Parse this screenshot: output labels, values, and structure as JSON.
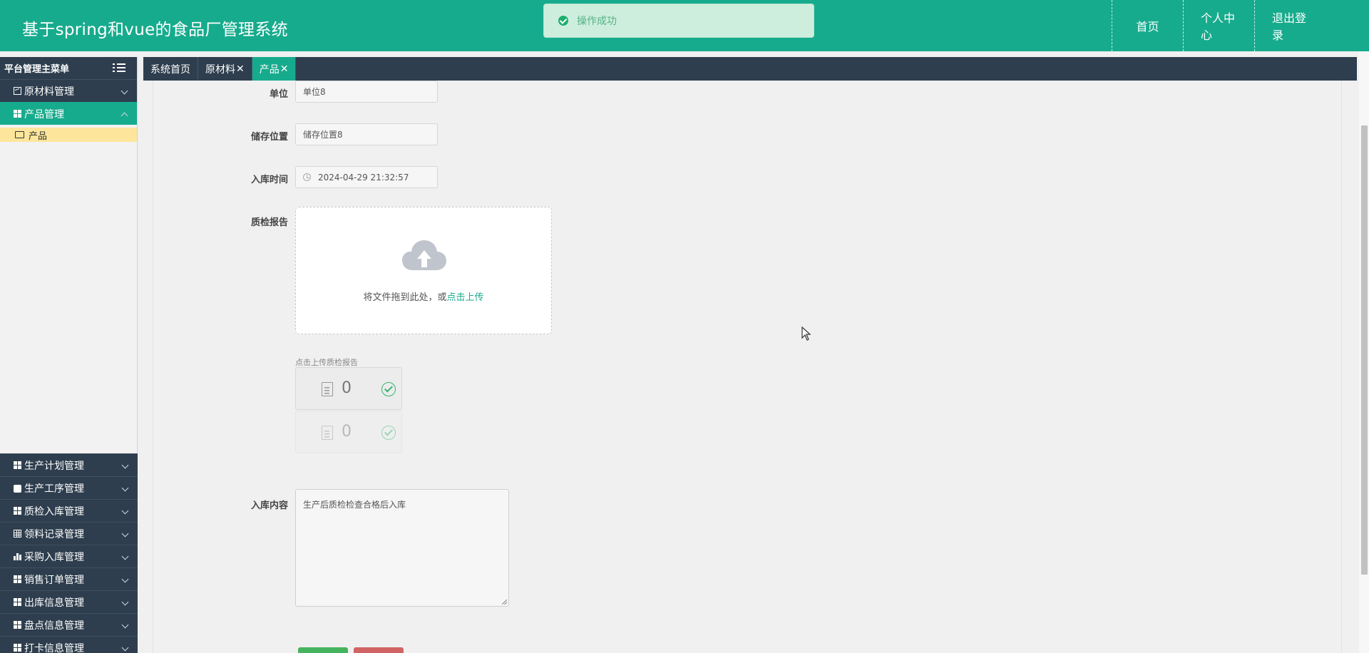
{
  "header": {
    "title": "基于spring和vue的食品厂管理系统",
    "nav": [
      "首页",
      "个人中心",
      "退出登录"
    ]
  },
  "toast": {
    "text": "操作成功",
    "icon": "success-check-icon"
  },
  "sidebar": {
    "title": "平台管理主菜单",
    "top_items": [
      {
        "label": "原材料管理",
        "icon": "chart-icon"
      },
      {
        "label": "产品管理",
        "icon": "grid-icon",
        "active": true
      }
    ],
    "sub_items": [
      {
        "label": "产品",
        "icon": "folder-icon"
      }
    ],
    "bottom_items": [
      {
        "label": "生产计划管理",
        "icon": "grid-icon"
      },
      {
        "label": "生产工序管理",
        "icon": "briefcase-icon"
      },
      {
        "label": "质检入库管理",
        "icon": "grid-icon"
      },
      {
        "label": "领料记录管理",
        "icon": "table-icon"
      },
      {
        "label": "采购入库管理",
        "icon": "bar-chart-icon"
      },
      {
        "label": "销售订单管理",
        "icon": "grid-icon"
      },
      {
        "label": "出库信息管理",
        "icon": "grid-icon"
      },
      {
        "label": "盘点信息管理",
        "icon": "grid-icon"
      },
      {
        "label": "打卡信息管理",
        "icon": "grid-icon"
      }
    ]
  },
  "tabs": [
    {
      "label": "系统首页",
      "closable": false
    },
    {
      "label": "原材料",
      "closable": true
    },
    {
      "label": "产品",
      "closable": true,
      "active": true
    }
  ],
  "form": {
    "unit": {
      "label": "单位",
      "value": "单位8"
    },
    "location": {
      "label": "储存位置",
      "value": "储存位置8"
    },
    "time": {
      "label": "入库时间",
      "value": "2024-04-29 21:32:57"
    },
    "report": {
      "label": "质检报告",
      "upload_text": "将文件拖到此处，或",
      "upload_link": "点击上传",
      "hint": "点击上传质检报告",
      "files": [
        {
          "name": "0"
        },
        {
          "name": "0"
        }
      ]
    },
    "content": {
      "label": "入库内容",
      "value": "生产后质检检查合格后入库"
    }
  },
  "colors": {
    "primary": "#17ab8d",
    "sidebar_dark": "#2e3e4e",
    "highlight": "#fde69b",
    "success": "#32b56e"
  }
}
